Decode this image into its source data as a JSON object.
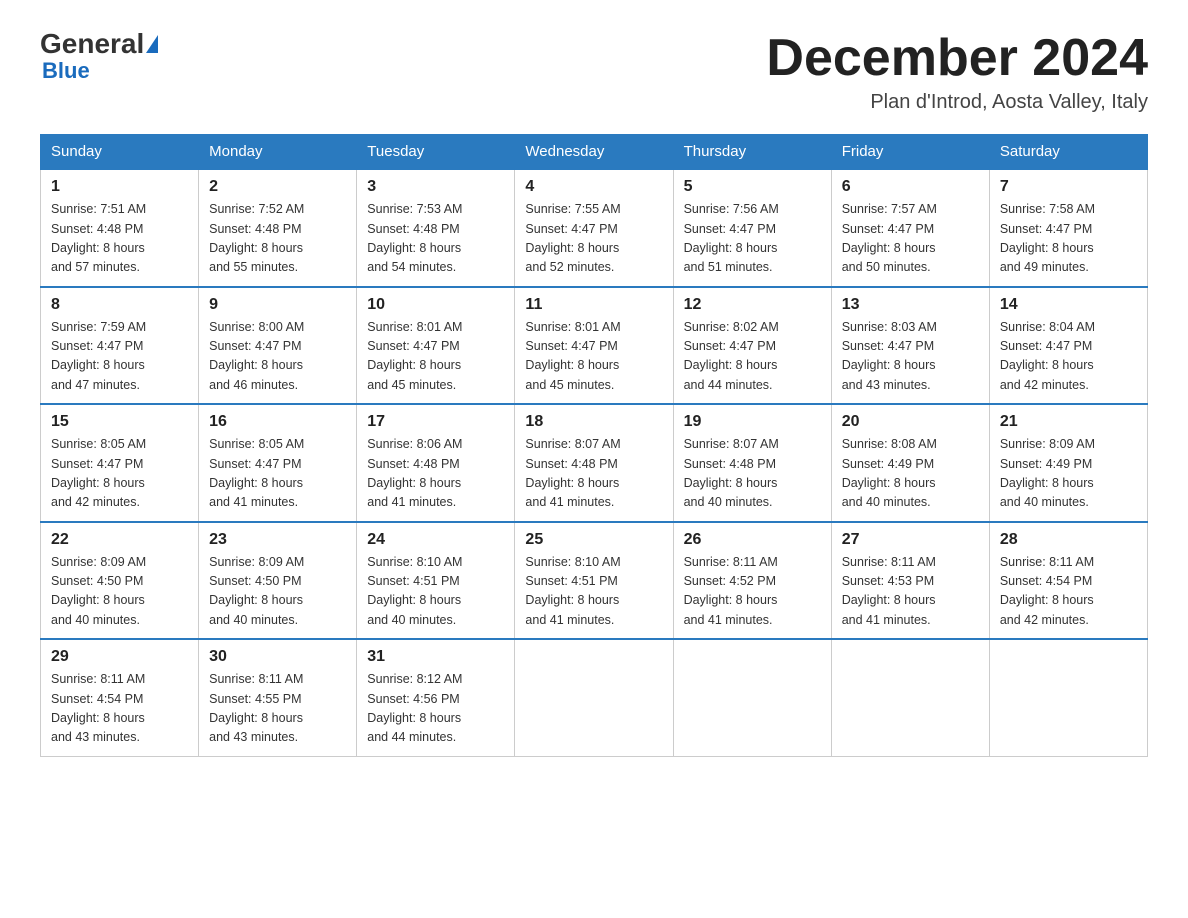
{
  "header": {
    "logo_general": "General",
    "logo_blue": "Blue",
    "month_title": "December 2024",
    "location": "Plan d'Introd, Aosta Valley, Italy"
  },
  "weekdays": [
    "Sunday",
    "Monday",
    "Tuesday",
    "Wednesday",
    "Thursday",
    "Friday",
    "Saturday"
  ],
  "weeks": [
    [
      {
        "day": "1",
        "sunrise": "7:51 AM",
        "sunset": "4:48 PM",
        "daylight": "8 hours and 57 minutes."
      },
      {
        "day": "2",
        "sunrise": "7:52 AM",
        "sunset": "4:48 PM",
        "daylight": "8 hours and 55 minutes."
      },
      {
        "day": "3",
        "sunrise": "7:53 AM",
        "sunset": "4:48 PM",
        "daylight": "8 hours and 54 minutes."
      },
      {
        "day": "4",
        "sunrise": "7:55 AM",
        "sunset": "4:47 PM",
        "daylight": "8 hours and 52 minutes."
      },
      {
        "day": "5",
        "sunrise": "7:56 AM",
        "sunset": "4:47 PM",
        "daylight": "8 hours and 51 minutes."
      },
      {
        "day": "6",
        "sunrise": "7:57 AM",
        "sunset": "4:47 PM",
        "daylight": "8 hours and 50 minutes."
      },
      {
        "day": "7",
        "sunrise": "7:58 AM",
        "sunset": "4:47 PM",
        "daylight": "8 hours and 49 minutes."
      }
    ],
    [
      {
        "day": "8",
        "sunrise": "7:59 AM",
        "sunset": "4:47 PM",
        "daylight": "8 hours and 47 minutes."
      },
      {
        "day": "9",
        "sunrise": "8:00 AM",
        "sunset": "4:47 PM",
        "daylight": "8 hours and 46 minutes."
      },
      {
        "day": "10",
        "sunrise": "8:01 AM",
        "sunset": "4:47 PM",
        "daylight": "8 hours and 45 minutes."
      },
      {
        "day": "11",
        "sunrise": "8:01 AM",
        "sunset": "4:47 PM",
        "daylight": "8 hours and 45 minutes."
      },
      {
        "day": "12",
        "sunrise": "8:02 AM",
        "sunset": "4:47 PM",
        "daylight": "8 hours and 44 minutes."
      },
      {
        "day": "13",
        "sunrise": "8:03 AM",
        "sunset": "4:47 PM",
        "daylight": "8 hours and 43 minutes."
      },
      {
        "day": "14",
        "sunrise": "8:04 AM",
        "sunset": "4:47 PM",
        "daylight": "8 hours and 42 minutes."
      }
    ],
    [
      {
        "day": "15",
        "sunrise": "8:05 AM",
        "sunset": "4:47 PM",
        "daylight": "8 hours and 42 minutes."
      },
      {
        "day": "16",
        "sunrise": "8:05 AM",
        "sunset": "4:47 PM",
        "daylight": "8 hours and 41 minutes."
      },
      {
        "day": "17",
        "sunrise": "8:06 AM",
        "sunset": "4:48 PM",
        "daylight": "8 hours and 41 minutes."
      },
      {
        "day": "18",
        "sunrise": "8:07 AM",
        "sunset": "4:48 PM",
        "daylight": "8 hours and 41 minutes."
      },
      {
        "day": "19",
        "sunrise": "8:07 AM",
        "sunset": "4:48 PM",
        "daylight": "8 hours and 40 minutes."
      },
      {
        "day": "20",
        "sunrise": "8:08 AM",
        "sunset": "4:49 PM",
        "daylight": "8 hours and 40 minutes."
      },
      {
        "day": "21",
        "sunrise": "8:09 AM",
        "sunset": "4:49 PM",
        "daylight": "8 hours and 40 minutes."
      }
    ],
    [
      {
        "day": "22",
        "sunrise": "8:09 AM",
        "sunset": "4:50 PM",
        "daylight": "8 hours and 40 minutes."
      },
      {
        "day": "23",
        "sunrise": "8:09 AM",
        "sunset": "4:50 PM",
        "daylight": "8 hours and 40 minutes."
      },
      {
        "day": "24",
        "sunrise": "8:10 AM",
        "sunset": "4:51 PM",
        "daylight": "8 hours and 40 minutes."
      },
      {
        "day": "25",
        "sunrise": "8:10 AM",
        "sunset": "4:51 PM",
        "daylight": "8 hours and 41 minutes."
      },
      {
        "day": "26",
        "sunrise": "8:11 AM",
        "sunset": "4:52 PM",
        "daylight": "8 hours and 41 minutes."
      },
      {
        "day": "27",
        "sunrise": "8:11 AM",
        "sunset": "4:53 PM",
        "daylight": "8 hours and 41 minutes."
      },
      {
        "day": "28",
        "sunrise": "8:11 AM",
        "sunset": "4:54 PM",
        "daylight": "8 hours and 42 minutes."
      }
    ],
    [
      {
        "day": "29",
        "sunrise": "8:11 AM",
        "sunset": "4:54 PM",
        "daylight": "8 hours and 43 minutes."
      },
      {
        "day": "30",
        "sunrise": "8:11 AM",
        "sunset": "4:55 PM",
        "daylight": "8 hours and 43 minutes."
      },
      {
        "day": "31",
        "sunrise": "8:12 AM",
        "sunset": "4:56 PM",
        "daylight": "8 hours and 44 minutes."
      },
      null,
      null,
      null,
      null
    ]
  ]
}
